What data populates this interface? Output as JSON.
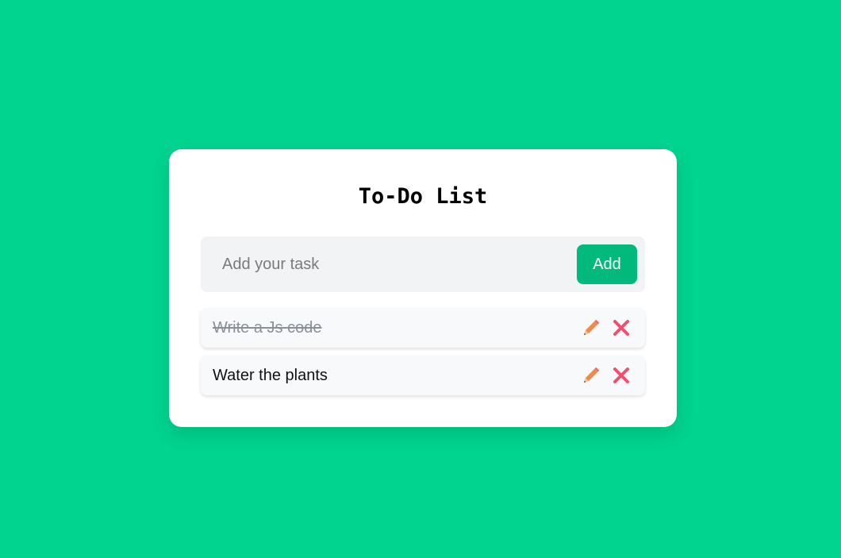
{
  "app": {
    "title": "To-Do List"
  },
  "input": {
    "placeholder": "Add your task",
    "value": ""
  },
  "buttons": {
    "add_label": "Add"
  },
  "tasks": [
    {
      "text": "Write a Js code",
      "completed": true
    },
    {
      "text": "Water the plants",
      "completed": false
    }
  ],
  "icons": {
    "edit": "pencil-icon",
    "delete": "close-icon"
  },
  "colors": {
    "background": "#00d48f",
    "card": "#ffffff",
    "add_button": "#00b97b",
    "pencil": "#f08a4b",
    "delete": "#f0506e",
    "completed_text": "#8a8f99"
  }
}
